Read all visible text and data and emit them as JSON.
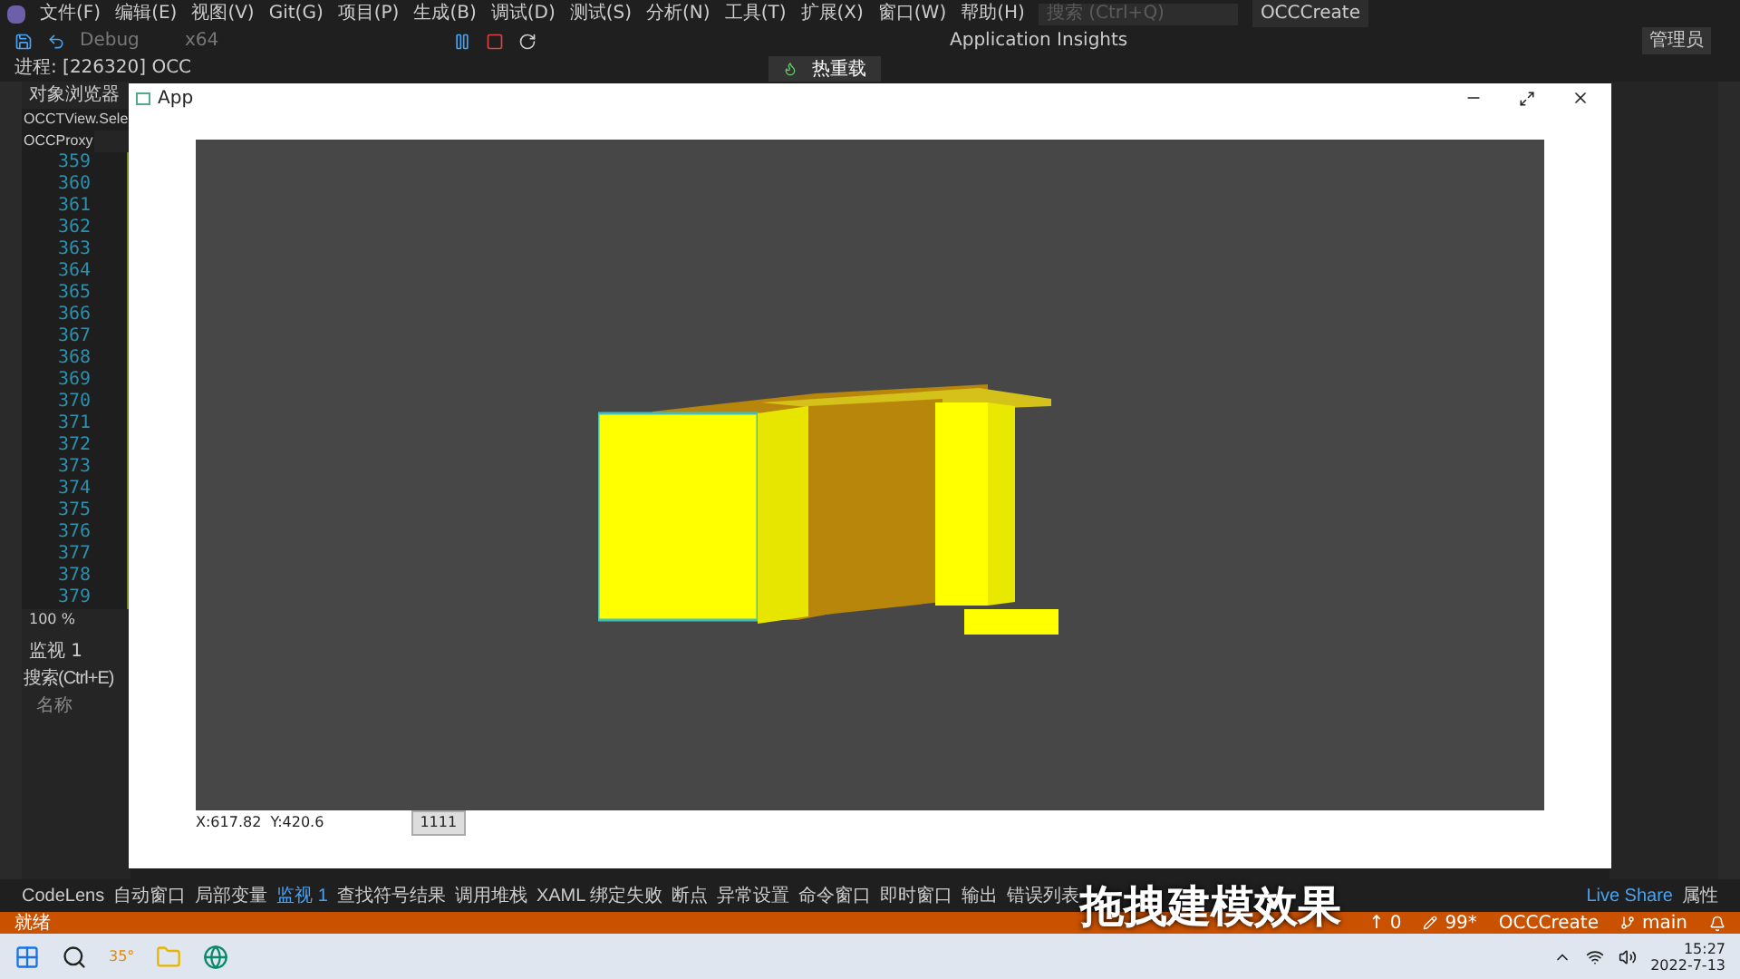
{
  "menu": [
    "文件(F)",
    "编辑(E)",
    "视图(V)",
    "Git(G)",
    "项目(P)",
    "生成(B)",
    "调试(D)",
    "测试(S)",
    "分析(N)",
    "工具(T)",
    "扩展(X)",
    "窗口(W)",
    "帮助(H)"
  ],
  "search": {
    "placeholder": "搜索 (Ctrl+Q)"
  },
  "solution_name": "OCCCreate",
  "toolbar": {
    "configuration": "Debug",
    "platform": "x64",
    "insights": "Application Insights",
    "admin": "管理员"
  },
  "process": "进程: [226320] OCC",
  "debug_toolbar": {
    "hot_reload": "热重载"
  },
  "left_panel": {
    "title": "对象浏览器",
    "items": [
      {
        "label": "OCCTView.Sele"
      },
      {
        "label": "OCCProxy"
      }
    ],
    "line_numbers": [
      "359",
      "360",
      "361",
      "362",
      "363",
      "364",
      "365",
      "366",
      "367",
      "368",
      "369",
      "370",
      "371",
      "372",
      "373",
      "374",
      "375",
      "376",
      "377",
      "378",
      "379"
    ],
    "zoom": "100 %",
    "watch_title": "监视 1",
    "watch_search": "搜索(Ctrl+E)",
    "watch_column": "名称"
  },
  "app_window": {
    "title": "App",
    "coords": "X:617.82  Y:420.6",
    "button": "1111"
  },
  "bottom_tabs": [
    {
      "label": "CodeLens",
      "selected": false
    },
    {
      "label": "自动窗口",
      "selected": false
    },
    {
      "label": "局部变量",
      "selected": false
    },
    {
      "label": "监视 1",
      "selected": true
    },
    {
      "label": "查找符号结果",
      "selected": false
    },
    {
      "label": "调用堆栈",
      "selected": false
    },
    {
      "label": "XAML 绑定失败",
      "selected": false
    },
    {
      "label": "断点",
      "selected": false
    },
    {
      "label": "异常设置",
      "selected": false
    },
    {
      "label": "命令窗口",
      "selected": false
    },
    {
      "label": "即时窗口",
      "selected": false
    },
    {
      "label": "输出",
      "selected": false
    },
    {
      "label": "错误列表",
      "selected": false
    }
  ],
  "right_tabs": [
    "Live Share",
    "属性"
  ],
  "subtitle": "拖拽建模效果",
  "status_bar": {
    "state": "就绪",
    "up": "↑ 0",
    "edits": "99*",
    "repo": "OCCCreate",
    "branch": "main"
  },
  "taskbar": {
    "weather": "35°",
    "time": "15:27",
    "date": "2022-7-13"
  }
}
